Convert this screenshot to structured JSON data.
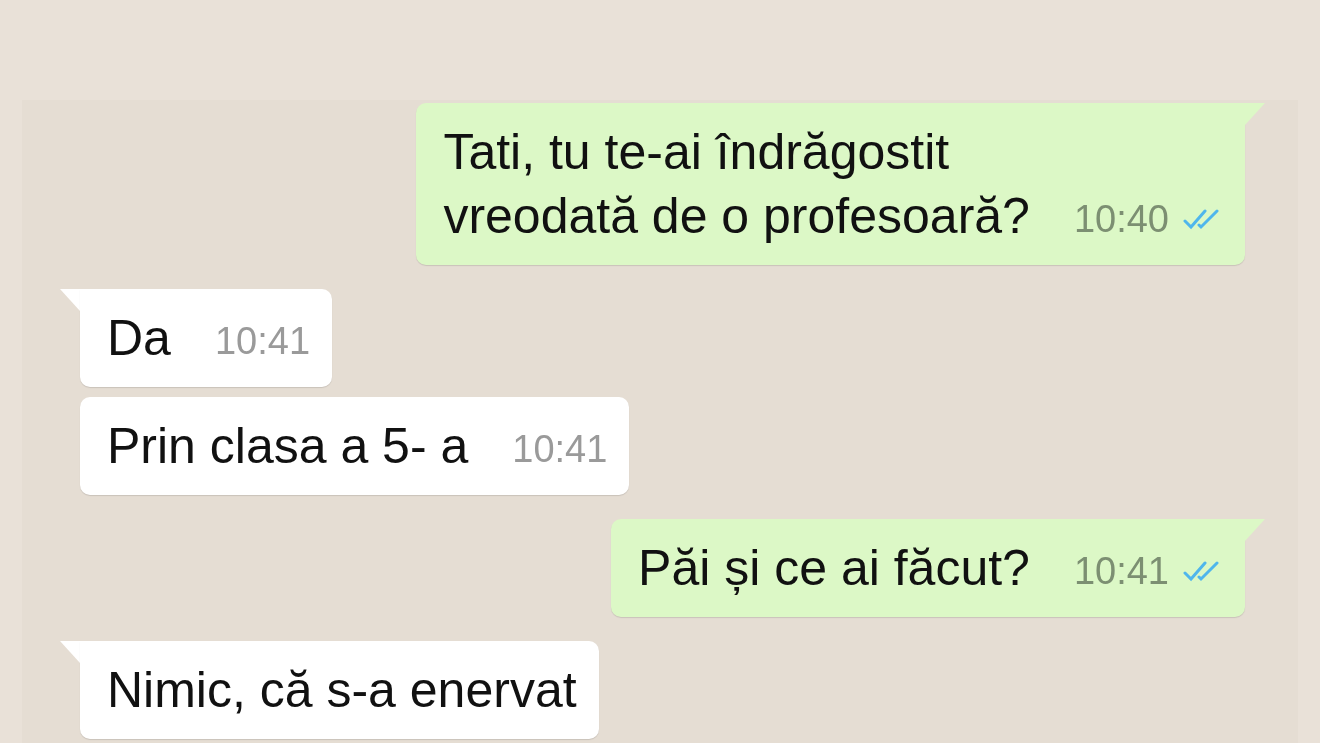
{
  "messages": [
    {
      "kind": "outgoing",
      "tail": true,
      "text": "Tati, tu te-ai îndrăgostit\nvreodată de o profesoară?",
      "time": "10:40",
      "read": true
    },
    {
      "kind": "incoming",
      "tail": true,
      "text": "Da",
      "time": "10:41"
    },
    {
      "kind": "incoming",
      "tail": false,
      "text": "Prin clasa a 5- a",
      "time": "10:41"
    },
    {
      "kind": "outgoing",
      "tail": true,
      "text": "Păi și ce ai făcut?",
      "time": "10:41",
      "read": true
    },
    {
      "kind": "incoming",
      "tail": true,
      "text": "Nimic, că s-a enervat"
    }
  ]
}
